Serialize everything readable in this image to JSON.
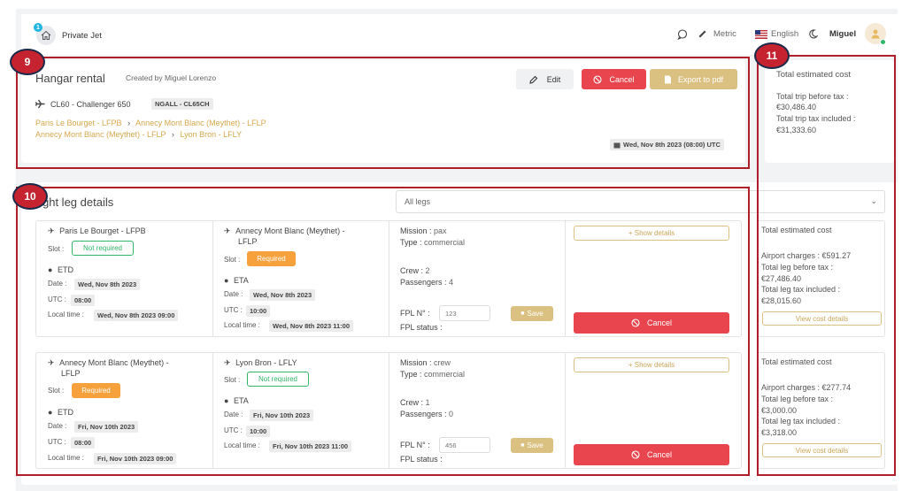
{
  "header": {
    "notification_count": "1",
    "app_title": "Private Jet",
    "metric_label": "Metric",
    "language_label": "English",
    "user_name": "Miguel"
  },
  "markers": {
    "m9": "9",
    "m10": "10",
    "m11": "11"
  },
  "trip": {
    "title": "Hangar rental",
    "created_by": "Created by Miguel Lorenzo",
    "aircraft": "CL60 - Challenger 650",
    "registration": "NGALL - CL65CH",
    "route1_from": "Paris Le Bourget - LFPB",
    "route1_to": "Annecy Mont Blanc (Meythet) - LFLP",
    "route2_from": "Annecy Mont Blanc (Meythet) - LFLP",
    "route2_to": "Lyon Bron - LFLY",
    "date": "Wed, Nov 8th 2023 (08:00) UTC",
    "edit_label": "Edit",
    "cancel_label": "Cancel",
    "export_label": "Export to pdf"
  },
  "trip_cost": {
    "title": "Total estimated cost",
    "before_tax_label": "Total trip before tax :",
    "before_tax_value": "€30,486.40",
    "tax_included_label": "Total trip tax included :",
    "tax_included_value": "€31,333.60"
  },
  "legs_section": {
    "title": "ght leg details",
    "filter_value": "All legs"
  },
  "labels": {
    "slot": "Slot :",
    "etd": "ETD",
    "eta": "ETA",
    "date": "Date :",
    "utc": "UTC :",
    "local_time": "Local time :",
    "mission": "Mission :",
    "type": "Type :",
    "crew": "Crew :",
    "passengers": "Passengers :",
    "fpl_no": "FPL N° :",
    "fpl_status": "FPL status :",
    "save": "Save",
    "show_details": "+ Show details",
    "cancel": "Cancel",
    "cost_title": "Total estimated cost",
    "airport_charges": "Airport charges :",
    "leg_before_tax": "Total leg before tax :",
    "leg_tax_included": "Total leg tax included :",
    "view_cost_details": "View cost details"
  },
  "legs": [
    {
      "departure": "Paris Le Bourget - LFPB",
      "dep_slot": "Not required",
      "dep_date": "Wed, Nov 8th 2023",
      "dep_utc": "08:00",
      "dep_local": "Wed, Nov 8th 2023 09:00",
      "arrival_line1": "Annecy Mont Blanc (Meythet) -",
      "arrival_line2": "LFLP",
      "arr_slot": "Required",
      "arr_date": "Wed, Nov 8th 2023",
      "arr_utc": "10:00",
      "arr_local": "Wed, Nov 8th 2023 11:00",
      "mission": "pax",
      "type": "commercial",
      "crew": "2",
      "passengers": "4",
      "fpl_no": "123",
      "cost": {
        "airport_charges": "€591.27",
        "before_tax": "€27,486.40",
        "tax_included": "€28,015.60"
      }
    },
    {
      "departure_line1": "Annecy Mont Blanc (Meythet) -",
      "departure_line2": "LFLP",
      "dep_slot": "Required",
      "dep_date": "Fri, Nov 10th 2023",
      "dep_utc": "08:00",
      "dep_local": "Fri, Nov 10th 2023 09:00",
      "arrival": "Lyon Bron - LFLY",
      "arr_slot": "Not required",
      "arr_date": "Fri, Nov 10th 2023",
      "arr_utc": "10:00",
      "arr_local": "Fri, Nov 10th 2023 11:00",
      "mission": "crew",
      "type": "commercial",
      "crew": "1",
      "passengers": "0",
      "fpl_no": "456",
      "cost": {
        "airport_charges": "€277.74",
        "before_tax": "€3,000.00",
        "tax_included": "€3,318.00"
      }
    }
  ]
}
